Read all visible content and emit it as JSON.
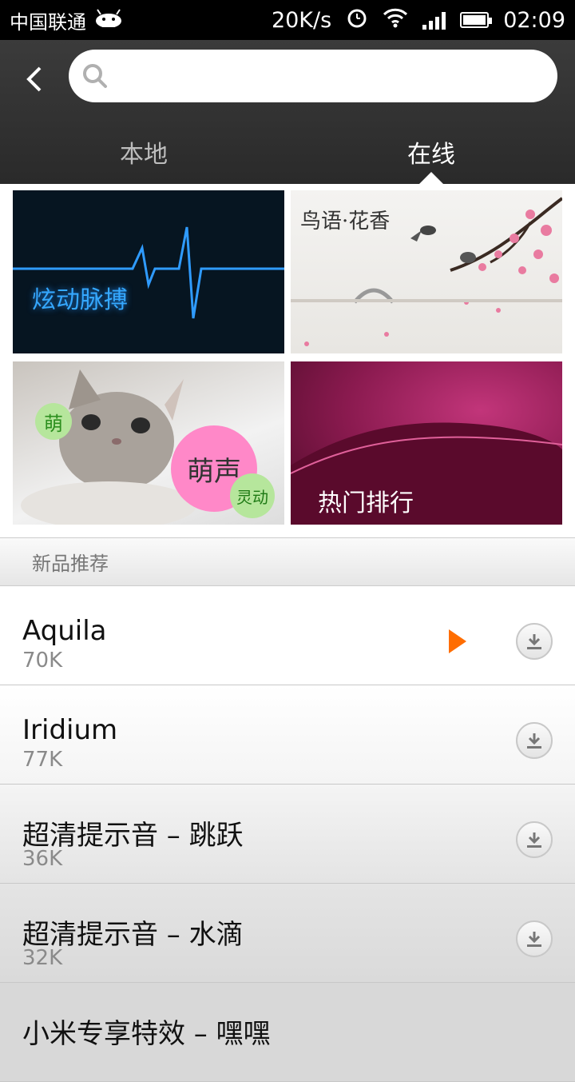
{
  "status": {
    "carrier": "中国联通",
    "speed": "20K/s",
    "time": "02:09"
  },
  "search": {
    "placeholder": ""
  },
  "tabs": [
    {
      "label": "本地",
      "active": false
    },
    {
      "label": "在线",
      "active": true
    }
  ],
  "banners": [
    {
      "label": "炫动脉搏"
    },
    {
      "label": "鸟语·花香"
    },
    {
      "label_big": "萌声",
      "label_small": "萌",
      "label_small2": "灵动"
    },
    {
      "label": "热门排行"
    }
  ],
  "section": {
    "title": "新品推荐"
  },
  "items": [
    {
      "name": "Aquila",
      "size": "70K"
    },
    {
      "name": "Iridium",
      "size": "77K"
    },
    {
      "name": "超清提示音 –  跳跃",
      "size": "36K"
    },
    {
      "name": "超清提示音 – 水滴",
      "size": "32K"
    },
    {
      "name": "小米专享特效 – 嘿嘿",
      "size": ""
    }
  ],
  "colors": {
    "accent": "#ff6d00",
    "header": "#333333"
  }
}
